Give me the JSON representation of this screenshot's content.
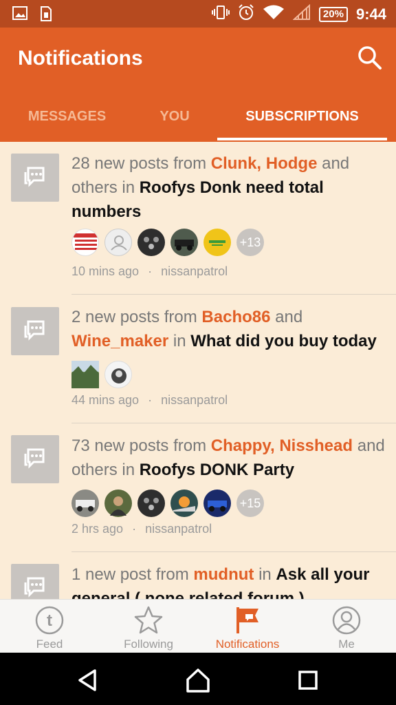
{
  "status_bar": {
    "battery": "20%",
    "time": "9:44"
  },
  "header": {
    "title": "Notifications"
  },
  "tabs": [
    {
      "label": "MESSAGES"
    },
    {
      "label": "YOU"
    },
    {
      "label": "SUBSCRIPTIONS"
    }
  ],
  "notifications": [
    {
      "prefix": "28 new posts from ",
      "users": "Clunk, Hodge",
      "middle": "  and others in ",
      "topic": "Roofys Donk need total numbers",
      "more": "+13",
      "time": "10 mins ago",
      "dot": "·",
      "forum": "nissanpatrol"
    },
    {
      "prefix": "2 new posts from ",
      "users": "Bacho86",
      "and": " and ",
      "users2": "Wine_maker",
      "middle": " in ",
      "topic": "What did you buy today",
      "time": "44 mins ago",
      "dot": "·",
      "forum": "nissanpatrol"
    },
    {
      "prefix": "73 new posts from ",
      "users": "Chappy, Nisshead",
      "middle": "  and others in ",
      "topic": "Roofys DONK Party",
      "more": "+15",
      "time": "2 hrs ago",
      "dot": "·",
      "forum": "nissanpatrol"
    },
    {
      "prefix": "1 new post from ",
      "users": "mudnut",
      "middle": " in ",
      "topic": "Ask all your general ( none related forum )"
    }
  ],
  "bottom_nav": [
    {
      "label": "Feed",
      "icon": "feed-icon"
    },
    {
      "label": "Following",
      "icon": "star-icon"
    },
    {
      "label": "Notifications",
      "icon": "flag-icon"
    },
    {
      "label": "Me",
      "icon": "profile-icon"
    }
  ],
  "colors": {
    "accent": "#e15f26",
    "status_bar": "#b64a1f",
    "background": "#fbecd7"
  }
}
